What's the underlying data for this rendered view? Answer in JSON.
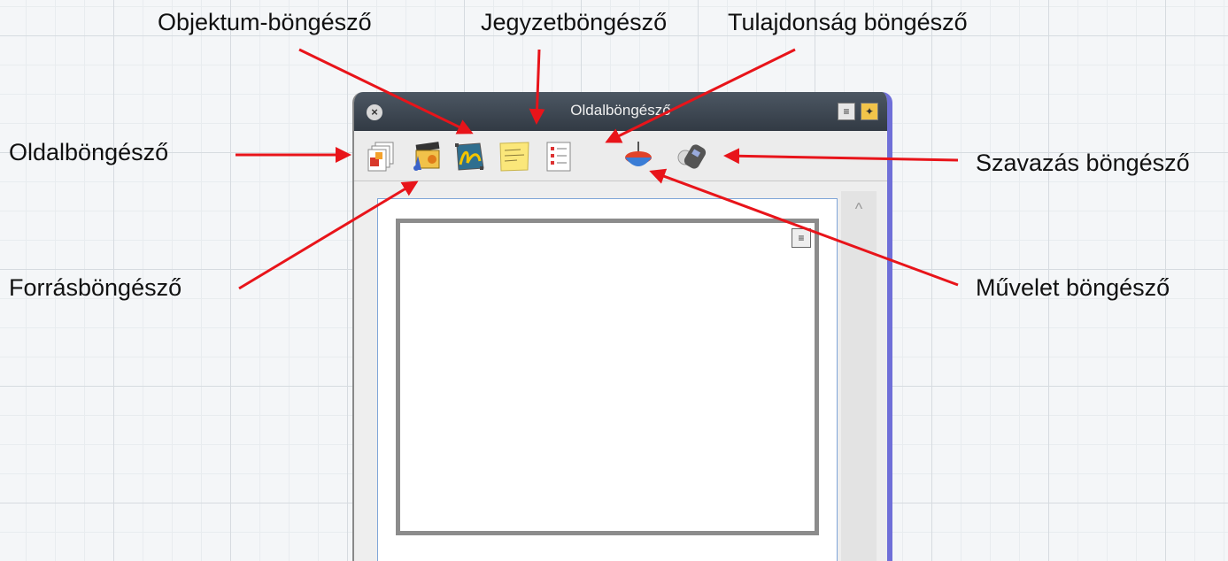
{
  "window": {
    "title": "Oldalböngésző",
    "close_glyph": "×",
    "menu_glyph": "≡",
    "pin_glyph": "✦"
  },
  "toolbar": {
    "icons": [
      {
        "name": "page-sorter-icon"
      },
      {
        "name": "gallery-icon"
      },
      {
        "name": "object-browser-icon"
      },
      {
        "name": "notes-icon"
      },
      {
        "name": "properties-icon"
      },
      {
        "name": "actions-icon"
      },
      {
        "name": "response-icon"
      }
    ]
  },
  "content": {
    "thumb_menu_glyph": "≡",
    "scroll_up_glyph": "^"
  },
  "callouts": {
    "object_browser": "Objektum-böngésző",
    "notes_browser": "Jegyzetböngésző",
    "properties_browser": "Tulajdonság böngésző",
    "page_browser": "Oldalböngésző",
    "voting_browser": "Szavazás böngésző",
    "resource_browser": "Forrásböngésző",
    "action_browser": "Művelet böngésző"
  },
  "colors": {
    "arrow": "#e8141a",
    "titlebar": "#3d4650",
    "panel_border": "#6f6fd8"
  }
}
